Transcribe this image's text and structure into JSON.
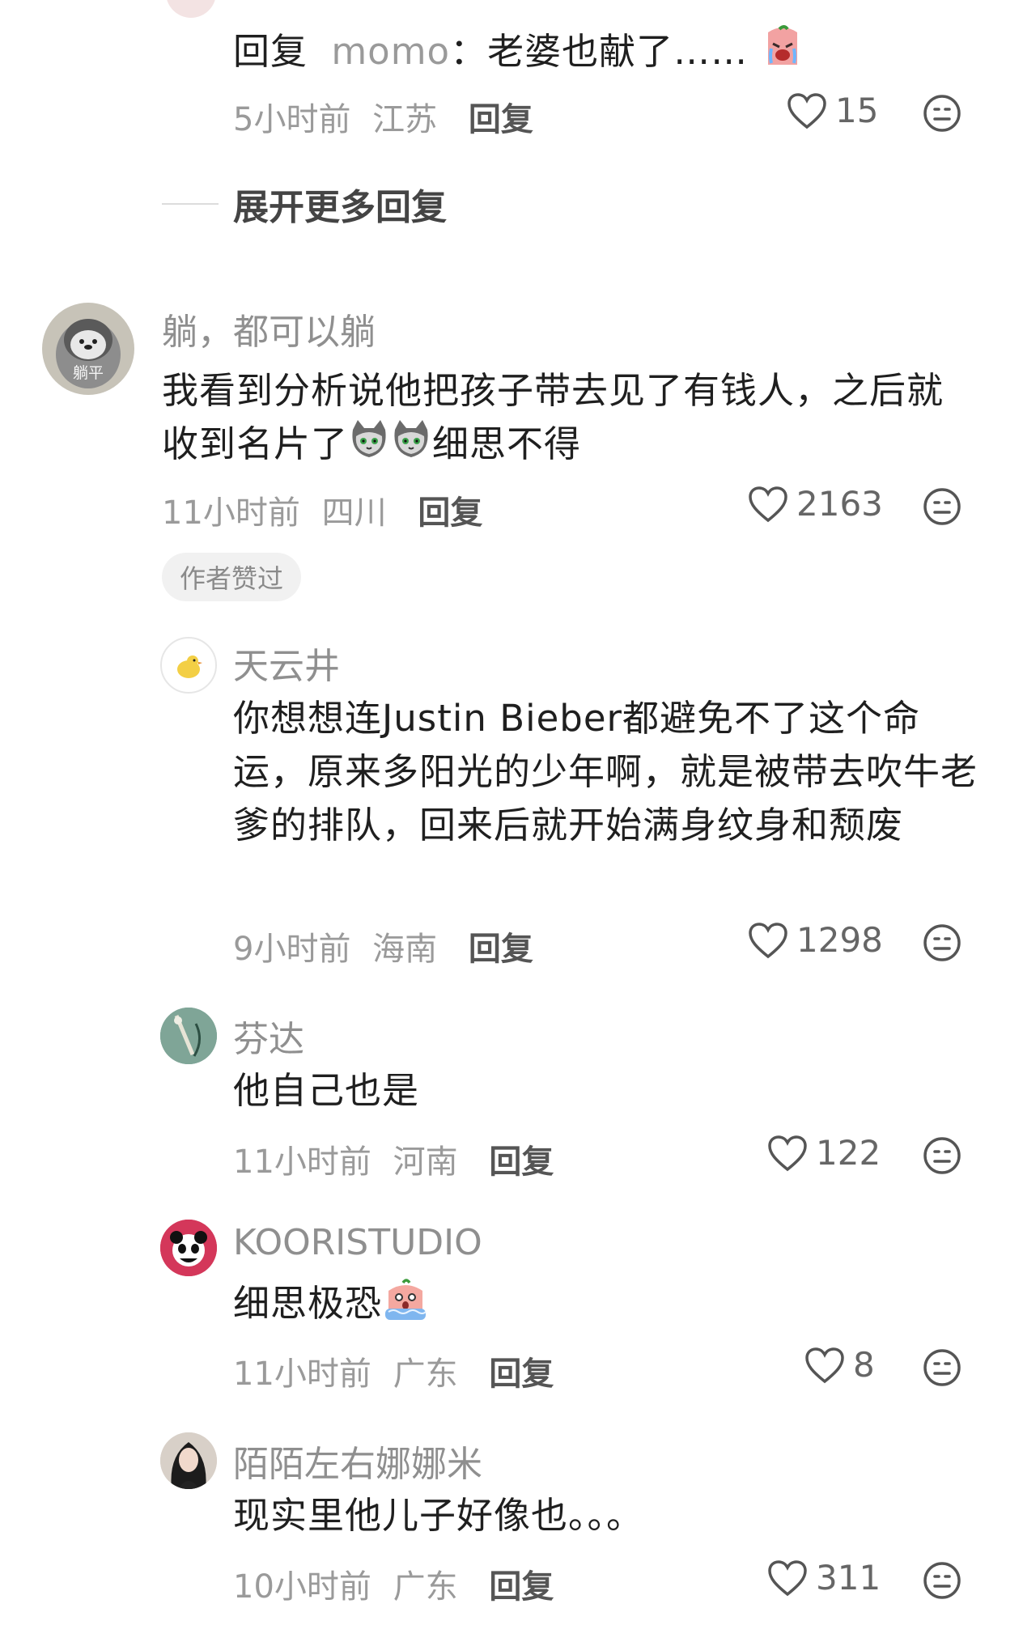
{
  "top_reply": {
    "reply_prefix": "回复",
    "reply_to": "momo",
    "text": "：老婆也献了……",
    "emoji_icon": "crying-peach-emoji",
    "time": "5小时前",
    "location": "江苏",
    "reply_label": "回复",
    "likes": "15"
  },
  "expand_more": "展开更多回复",
  "main_comment": {
    "username": "躺，都可以躺",
    "avatar_text": "躺平",
    "text_before": "我看到分析说他把孩子带去见了有钱人，之后就收到名片了",
    "emoji_icon": "cat-emoji",
    "text_after": "细思不得",
    "time": "11小时前",
    "location": "四川",
    "reply_label": "回复",
    "likes": "2163",
    "badge": "作者赞过"
  },
  "replies": [
    {
      "username": "天云井",
      "text": "你想想连Justin Bieber都避免不了这个命运，原来多阳光的少年啊，就是被带去吹牛老爹的排队，回来后就开始满身纹身和颓废",
      "time": "9小时前",
      "location": "海南",
      "reply_label": "回复",
      "likes": "1298"
    },
    {
      "username": "芬达",
      "text": "他自己也是",
      "time": "11小时前",
      "location": "河南",
      "reply_label": "回复",
      "likes": "122"
    },
    {
      "username": "KOORISTUDIO",
      "text": "细思极恐",
      "emoji_icon": "scared-peach-emoji",
      "time": "11小时前",
      "location": "广东",
      "reply_label": "回复",
      "likes": "8"
    },
    {
      "username": "陌陌左右娜娜米",
      "text": "现实里他儿子好像也。。。",
      "time": "10小时前",
      "location": "广东",
      "reply_label": "回复",
      "likes": "311"
    }
  ]
}
